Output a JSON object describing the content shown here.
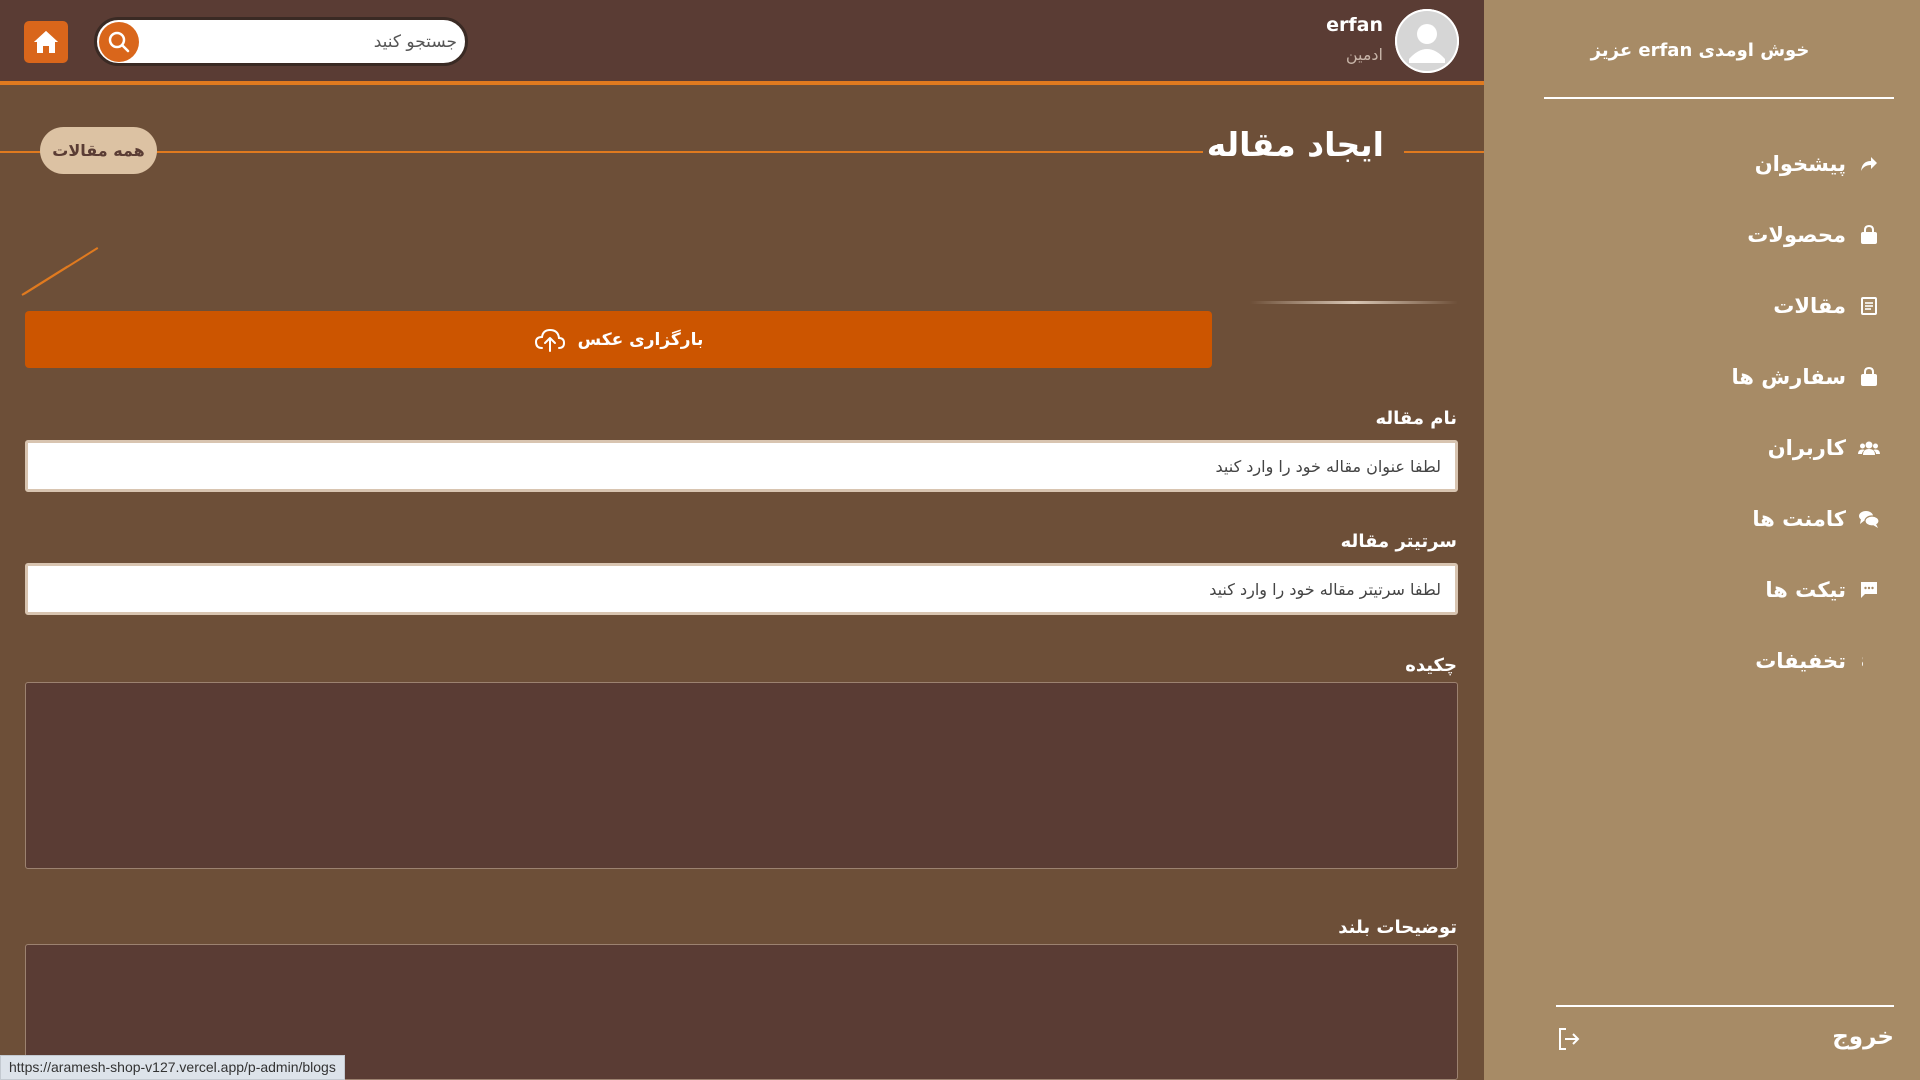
{
  "header": {
    "search_placeholder": "جستجو کنید",
    "user_name": "erfan",
    "user_role": "ادمین"
  },
  "page": {
    "title": "ایجاد مقاله",
    "all_blogs_label": "همه مقالات",
    "upload_label": "بارگزاری عکس"
  },
  "form": {
    "title_label": "نام مقاله",
    "title_placeholder": "لطفا عنوان مقاله خود را وارد کنید",
    "subtitle_label": "سرتیتر مقاله",
    "subtitle_placeholder": "لطفا سرتیتر مقاله خود را وارد کنید",
    "summary_label": "چکیده",
    "description_label": "توضیحات بلند"
  },
  "sidebar": {
    "welcome": "خوش اومدی erfan عزیز",
    "items": [
      {
        "label": "پیشخوان",
        "icon": "reply-arrow-icon"
      },
      {
        "label": "محصولات",
        "icon": "shopping-bag-icon"
      },
      {
        "label": "مقالات",
        "icon": "document-icon"
      },
      {
        "label": "سفارش ها",
        "icon": "shopping-bag-icon"
      },
      {
        "label": "کاربران",
        "icon": "users-icon"
      },
      {
        "label": "کامنت ها",
        "icon": "comments-icon"
      },
      {
        "label": "تیکت ها",
        "icon": "message-icon"
      },
      {
        "label": "تخفیفات",
        "icon": "dollar-icon"
      }
    ],
    "logout_label": "خروج"
  },
  "status_bar": {
    "url": "https://aramesh-shop-v127.vercel.app/p-admin/blogs"
  },
  "colors": {
    "accent": "#cc5500",
    "header_bg": "#5a3c34",
    "main_bg": "#6d4f38",
    "sidebar_bg": "#a78b66"
  }
}
